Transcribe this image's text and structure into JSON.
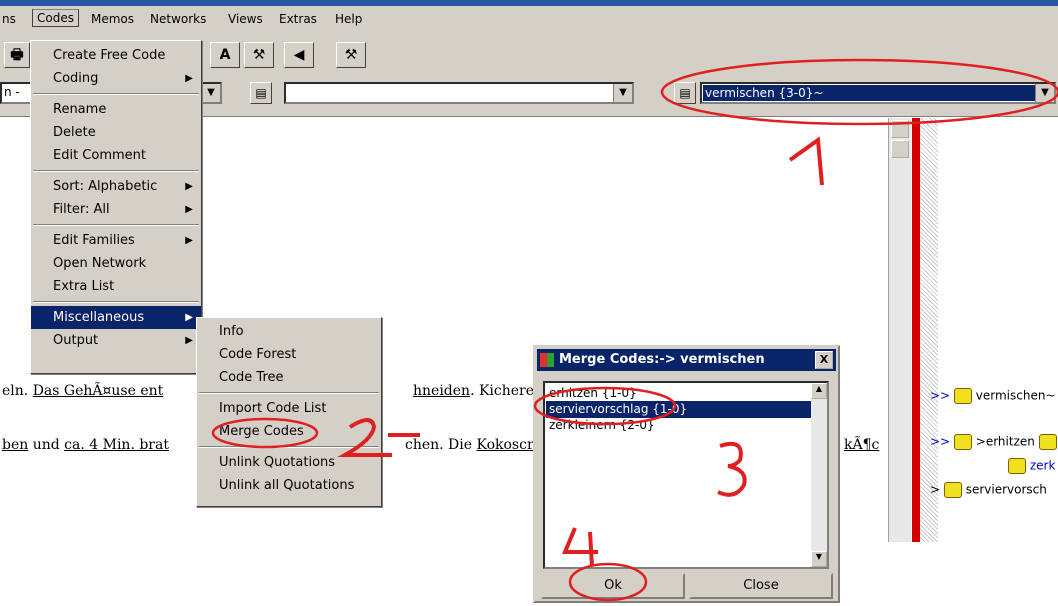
{
  "menubar": {
    "items": [
      "ns",
      "Codes",
      "Memos",
      "Networks",
      "Views",
      "Extras",
      "Help"
    ]
  },
  "toolbar": {
    "combo_left_value": "n -",
    "combo_middle_value": "",
    "combo_right_value": "vermischen {3-0}~"
  },
  "codes_menu": {
    "items": [
      {
        "label": "Create Free Code",
        "sub": false
      },
      {
        "label": "Coding",
        "sub": true
      },
      {
        "label": "Rename",
        "sub": false
      },
      {
        "label": "Delete",
        "sub": false
      },
      {
        "label": "Edit Comment",
        "sub": false
      },
      {
        "label": "Sort: Alphabetic",
        "sub": true
      },
      {
        "label": "Filter: All",
        "sub": true
      },
      {
        "label": "Edit Families",
        "sub": true
      },
      {
        "label": "Open Network",
        "sub": false
      },
      {
        "label": "Extra List",
        "sub": false
      },
      {
        "label": "Miscellaneous",
        "sub": true
      },
      {
        "label": "Output",
        "sub": true
      }
    ]
  },
  "misc_menu": {
    "items": [
      "Info",
      "Code Forest",
      "Code Tree",
      "Import Code List",
      "Merge Codes",
      "Unlink Quotations",
      "Unlink all Quotations"
    ]
  },
  "document": {
    "line1_a": "eln.",
    "line1_b": "Das GehÃ¤use ent",
    "line1_c": "hneiden",
    "line1_d": ". Kichererb",
    "line2_a": "ben",
    "line2_b": " und ",
    "line2_c": "ca. 4 Min. brat",
    "line2_d": "chen. Die ",
    "line2_e": "Kokoscr",
    "line2_f": "kÃ¶c"
  },
  "dialog": {
    "title": "Merge Codes:-> vermischen",
    "close_glyph": "X",
    "list": [
      "erhitzen {1-0}",
      "serviervorschlag {1-0}",
      "zerkleinern {2-0}"
    ],
    "ok_label": "Ok",
    "close_label": "Close"
  },
  "right_panel": {
    "prefix_1": ">>",
    "code_1": "vermischen~",
    "prefix_2": ">>",
    "code_2": ">erhitzen",
    "code_3": "zerk",
    "prefix_4": ">",
    "code_4": "serviervorsch"
  },
  "annotations": {
    "n1": "1",
    "n2": "2",
    "n3": "3",
    "n4": "4"
  },
  "colors": {
    "selection": "#0a246a",
    "annotation_red": "#e02020",
    "margin_red": "#d40000"
  }
}
